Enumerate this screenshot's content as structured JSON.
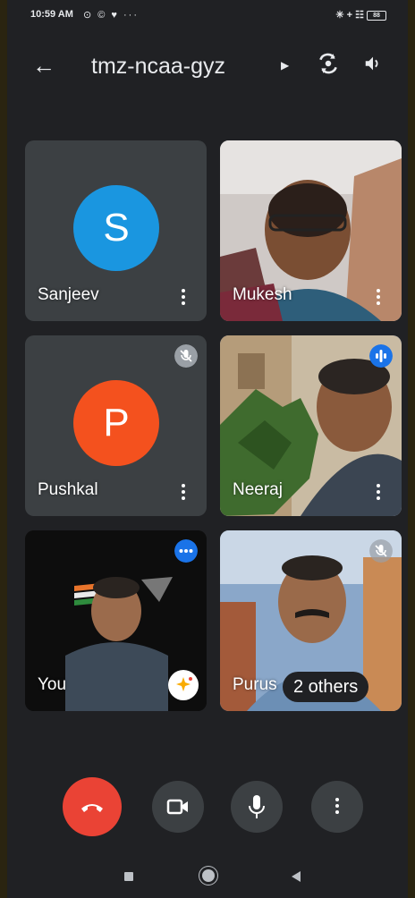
{
  "status_bar": {
    "time": "10:59 AM",
    "left_icons": "⊙ © ♥ ···",
    "right_icons": "✳ + ☷",
    "battery": "88"
  },
  "header": {
    "meeting_code": "tmz-ncaa-gyz"
  },
  "participants": [
    {
      "name": "Sanjeev",
      "initial": "S",
      "avatar_color": "#1a96e0"
    },
    {
      "name": "Mukesh"
    },
    {
      "name": "Pushkal",
      "initial": "P",
      "avatar_color": "#f4511e"
    },
    {
      "name": "Neeraj"
    },
    {
      "name": "You"
    },
    {
      "name": "Purus"
    }
  ],
  "others_chip": "2 others",
  "colors": {
    "background": "#202124",
    "tile": "#3c4043",
    "end_call": "#ea4335",
    "speaking_border": "#1a3f9e",
    "accent_blue": "#1a73e8"
  },
  "icons": [
    "back-arrow-icon",
    "switch-camera-icon",
    "speaker-icon",
    "more-vert-icon",
    "mic-off-icon",
    "speaking-icon",
    "camera-icon",
    "mic-icon",
    "call-end-icon"
  ]
}
